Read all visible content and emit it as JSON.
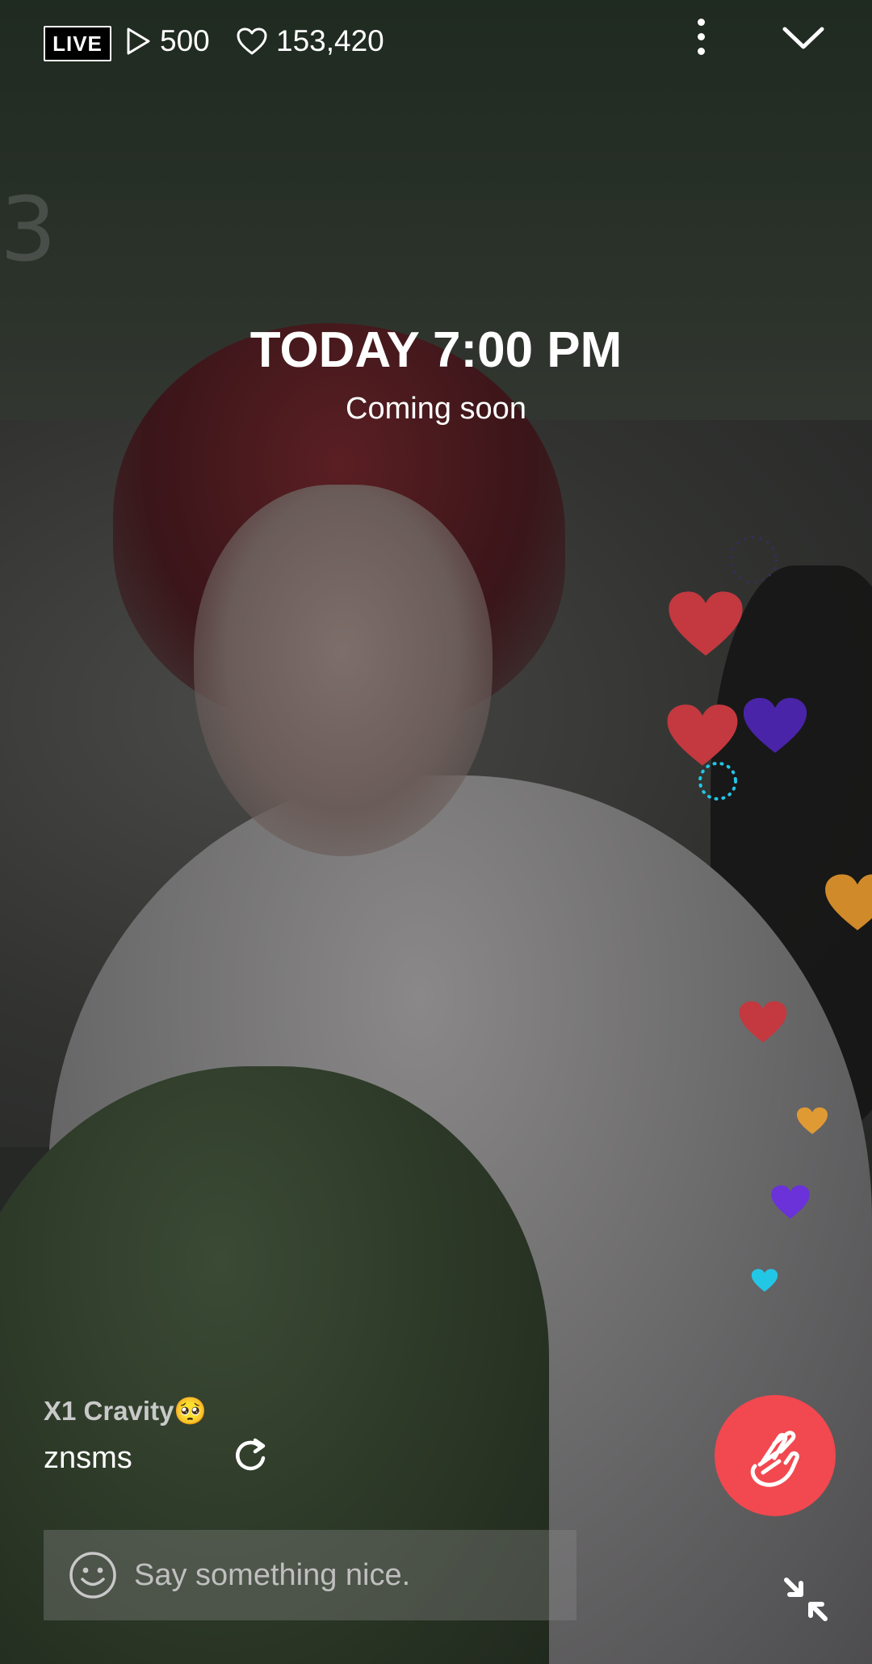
{
  "header": {
    "live_badge": "LIVE",
    "viewers": "500",
    "likes": "153,420"
  },
  "schedule": {
    "time": "TODAY 7:00 PM",
    "status": "Coming soon"
  },
  "chat": {
    "comments": [
      {
        "user": "X1 Cravity🥺",
        "text": "znsms"
      }
    ]
  },
  "composer": {
    "placeholder": "Say something nice."
  },
  "icons": {
    "play": "play-icon",
    "like": "heart-outline-icon",
    "more": "more-vertical-icon",
    "close": "chevron-down-icon",
    "refresh": "refresh-icon",
    "emoji": "smile-icon",
    "finger_heart": "finger-heart-icon",
    "collapse": "collapse-icon"
  },
  "colors": {
    "accent": "#f2484f",
    "heart_red": "#c3393f",
    "heart_purple": "#4a24a8",
    "heart_orange": "#d08a2a",
    "heart_violet": "#6a32d8",
    "heart_cyan": "#22c7e6"
  }
}
